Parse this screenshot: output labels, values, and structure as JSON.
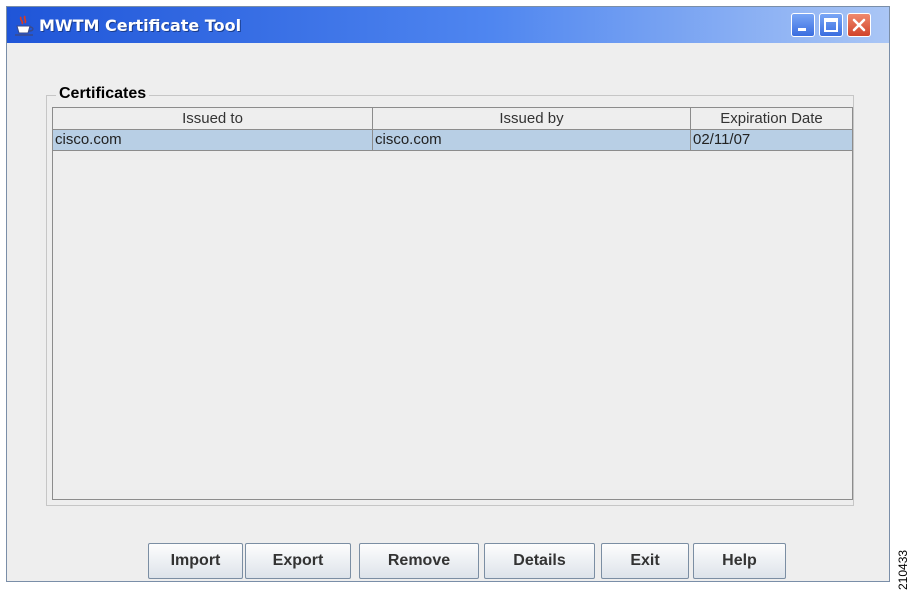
{
  "window": {
    "title": "MWTM Certificate Tool",
    "icon": "java-cup-icon"
  },
  "group": {
    "label": "Certificates"
  },
  "table": {
    "columns": [
      "Issued to",
      "Issued by",
      "Expiration Date"
    ],
    "rows": [
      {
        "issued_to": "cisco.com",
        "issued_by": "cisco.com",
        "expiration": "02/11/07",
        "selected": true
      }
    ]
  },
  "buttons": {
    "import": "Import",
    "export": "Export",
    "remove": "Remove",
    "details": "Details",
    "exit": "Exit",
    "help": "Help"
  },
  "figure_id": "210433",
  "colors": {
    "selection": "#b8cfe5",
    "titlebar": "#1f55d8",
    "close_button": "#d1432a"
  }
}
